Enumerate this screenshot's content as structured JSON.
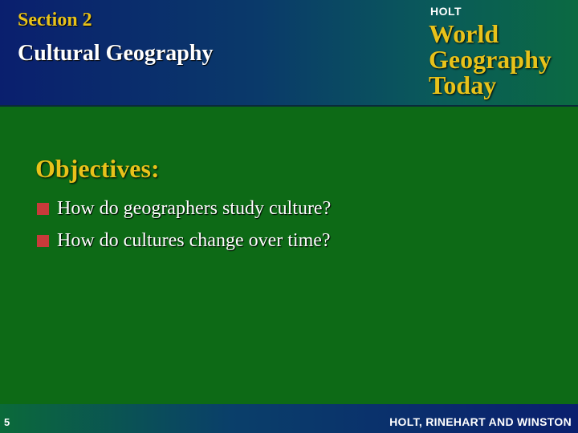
{
  "header": {
    "section_label": "Section 2",
    "section_title": "Cultural Geography",
    "brand_small": "HOLT",
    "brand_title_lines": [
      "World",
      "Geography",
      "Today"
    ]
  },
  "content": {
    "heading": "Objectives:",
    "bullets": [
      "How do geographers study culture?",
      "How do cultures change over time?"
    ]
  },
  "footer": {
    "page_number": "5",
    "publisher": "HOLT, RINEHART AND WINSTON"
  },
  "colors": {
    "background_green": "#0d6a16",
    "header_blue": "#0a1f6e",
    "gold_text": "#e8c21a",
    "bullet_red": "#c93a3a"
  }
}
